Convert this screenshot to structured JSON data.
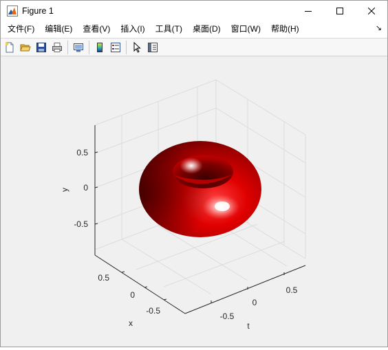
{
  "window": {
    "title": "Figure 1",
    "icon": "matlab-icon",
    "controls": [
      "minimize-icon",
      "maximize-icon",
      "close-icon"
    ]
  },
  "menubar": {
    "items": [
      {
        "label": "文件(F)"
      },
      {
        "label": "编辑(E)"
      },
      {
        "label": "查看(V)"
      },
      {
        "label": "插入(I)"
      },
      {
        "label": "工具(T)"
      },
      {
        "label": "桌面(D)"
      },
      {
        "label": "窗口(W)"
      },
      {
        "label": "帮助(H)"
      }
    ],
    "dock_arrow": "↘"
  },
  "toolbar": {
    "buttons": [
      {
        "icon": "new-figure-icon"
      },
      {
        "icon": "open-file-icon"
      },
      {
        "icon": "save-icon"
      },
      {
        "icon": "print-icon"
      },
      {
        "icon": "link-plot-icon"
      },
      {
        "icon": "insert-colorbar-icon"
      },
      {
        "icon": "insert-legend-icon"
      },
      {
        "icon": "edit-plot-arrow-icon"
      },
      {
        "icon": "property-inspector-icon"
      }
    ]
  },
  "plot": {
    "type": "3d-surface",
    "surface": "torus",
    "surface_color": "#e00000",
    "axis_labels": {
      "x": "x",
      "y": "y",
      "t": "t"
    },
    "y_ticks": [
      "0.5",
      "0",
      "-0.5"
    ],
    "x_ticks": [
      "0.5",
      "0",
      "-0.5"
    ],
    "t_ticks": [
      "-0.5",
      "0",
      "0.5"
    ],
    "background": "#f0f0f0",
    "box_color": "#262626",
    "grid_color": "#dcdcdc"
  }
}
